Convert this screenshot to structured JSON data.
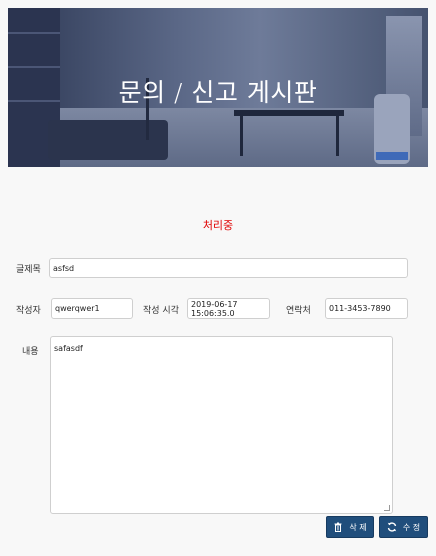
{
  "banner": {
    "title": "문의 / 신고 게시판"
  },
  "status": {
    "text": "처리중"
  },
  "form": {
    "title_label": "글제목",
    "title_value": "asfsd",
    "author_label": "작성자",
    "author_value": "qwerqwer1",
    "time_label": "작성 시각",
    "time_value": "2019-06-17 15:06:35.0",
    "contact_label": "연락처",
    "contact_value": "011-3453-7890",
    "content_label": "내용",
    "content_value": "safasdf"
  },
  "buttons": {
    "delete_label": "삭 제",
    "delete_icon": "trash-icon",
    "edit_label": "수 정",
    "edit_icon": "refresh-icon"
  },
  "colors": {
    "status": "#e00000",
    "button": "#204e7c"
  }
}
